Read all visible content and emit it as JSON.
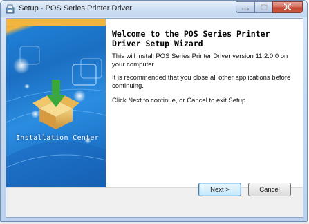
{
  "window": {
    "title": "Setup - POS Series Printer Driver"
  },
  "side_panel": {
    "label": "Installation Center"
  },
  "welcome": {
    "title_line1": "Welcome to the POS Series Printer",
    "title_line2": "Driver Setup Wizard",
    "para1": "This will install POS Series Printer Driver version 11.2.0.0 on your computer.",
    "para2": "It is recommended that you close all other applications before continuing.",
    "para3": "Click Next to continue, or Cancel to exit Setup."
  },
  "buttons": {
    "next_label": "Next >",
    "cancel_label": "Cancel"
  },
  "icons": {
    "app": "setup-app-icon",
    "minimize": "minimize-icon",
    "maximize": "maximize-icon",
    "close": "close-icon",
    "box": "installation-box-icon"
  },
  "colors": {
    "accent_blue": "#1f7fd4",
    "close_red": "#c24631",
    "next_border": "#3c7fb1"
  }
}
